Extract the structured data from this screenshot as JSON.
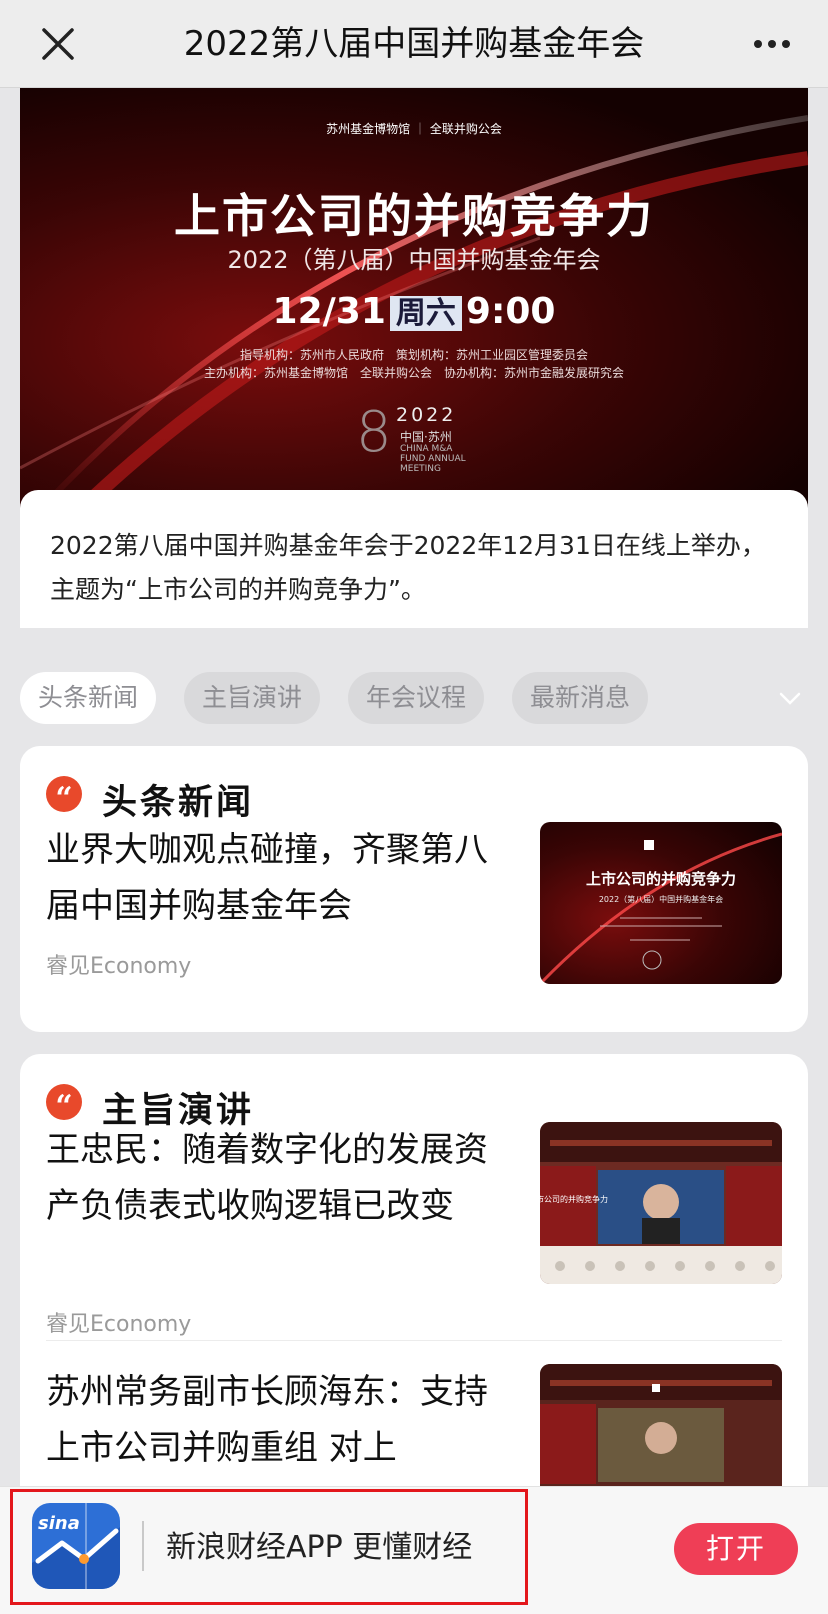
{
  "nav": {
    "title": "2022第八届中国并购基金年会",
    "close_icon": "close-icon",
    "more_icon": "more-icon"
  },
  "banner": {
    "logo_left": "苏州基金博物馆",
    "logo_right": "全联并购公会",
    "headline": "上市公司的并购竞争力",
    "subtitle": "2022（第八届）中国并购基金年会",
    "date": "12/31",
    "weekday": "周六",
    "time": "9:00",
    "org_line1": "指导机构：苏州市人民政府　策划机构：苏州工业园区管理委员会",
    "org_line2": "主办机构：苏州基金博物馆　全联并购公会　协办机构：苏州市金融发展研究会",
    "emblem_number": "8",
    "emblem_year": "2022",
    "emblem_cn": "中国·苏州",
    "emblem_en": "CHINA M&A FUND ANNUAL MEETING"
  },
  "intro": {
    "text": "2022第八届中国并购基金年会于2022年12月31日在线上举办，主题为“上市公司的并购竞争力”。"
  },
  "tabs": [
    {
      "label": "头条新闻",
      "active": true
    },
    {
      "label": "主旨演讲",
      "active": false
    },
    {
      "label": "年会议程",
      "active": false
    },
    {
      "label": "最新消息",
      "active": false
    }
  ],
  "sections": [
    {
      "title": "头条新闻",
      "articles": [
        {
          "title": "业界大咖观点碰撞，齐聚第八届中国并购基金年会",
          "source": "睿见Economy"
        }
      ]
    },
    {
      "title": "主旨演讲",
      "articles": [
        {
          "title": "王忠民：随着数字化的发展资产负债表式收购逻辑已改变",
          "source": "睿见Economy"
        },
        {
          "title": "苏州常务副市长顾海东：支持上市公司并购重组 对上",
          "source": ""
        }
      ]
    }
  ],
  "thumbs": {
    "headline_text": "上市公司的并购竞争力",
    "sub_text": "2022（第八届）中国并购基金年会",
    "stage_text": "上市公司的并购竞争力"
  },
  "promo": {
    "app_icon_text": "sina",
    "text": "新浪财经APP 更懂财经",
    "open_label": "打开"
  },
  "colors": {
    "accent_red": "#e8492b",
    "open_button": "#ef3e56",
    "highlight_box": "#e3171c"
  }
}
